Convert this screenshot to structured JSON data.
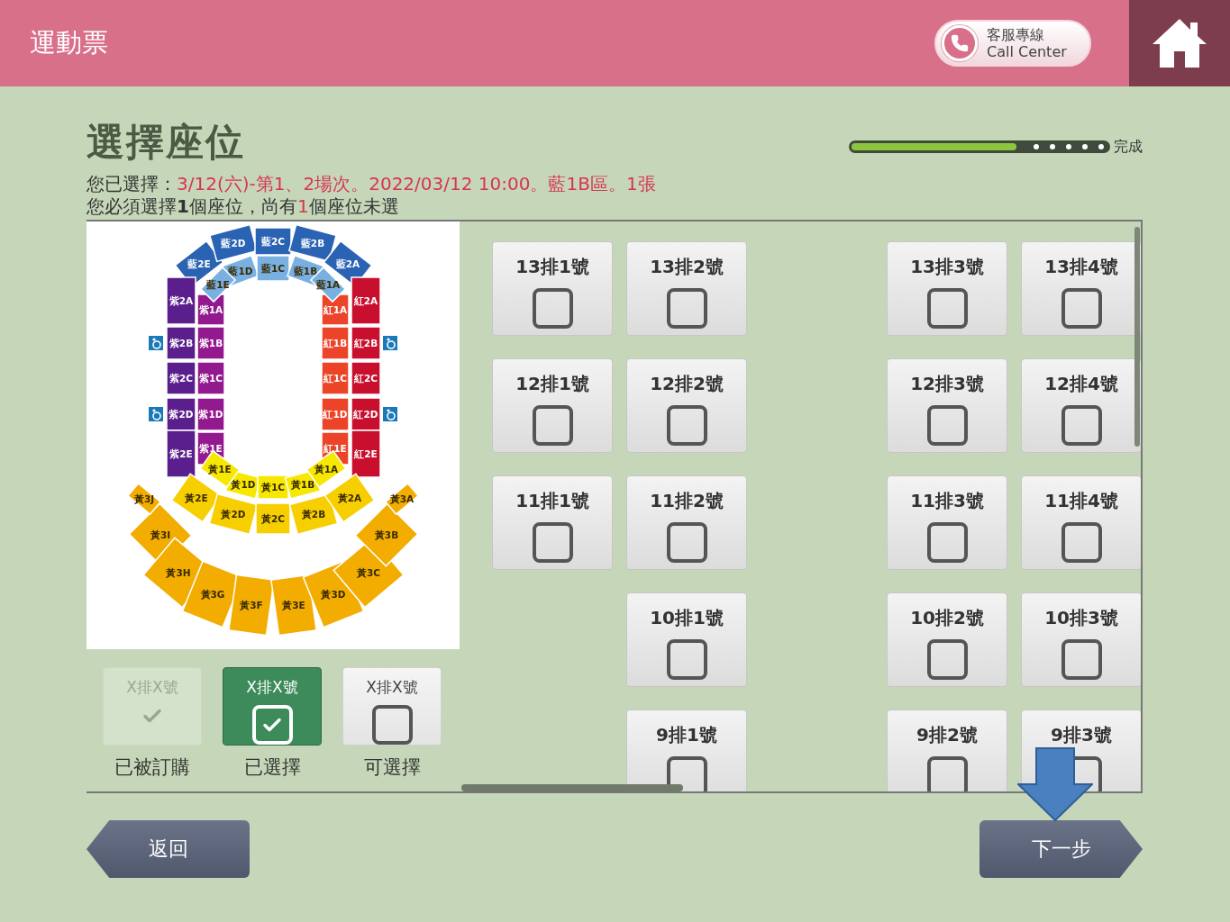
{
  "header": {
    "title": "運動票",
    "call_center": {
      "line_1": "客服專線",
      "line_2": "Call Center"
    }
  },
  "page_title": "選擇座位",
  "progress": {
    "level": 0.65,
    "label": "完成"
  },
  "summary_lines": [
    {
      "segments": [
        {
          "text": "您已選擇：",
          "kind": "plain"
        },
        {
          "text": "3/12(六)-第1、2場次。2022/03/12 10:00。藍1B區。1張",
          "kind": "selection"
        }
      ]
    },
    {
      "segments": [
        {
          "text": "您必須選擇",
          "kind": "plain"
        },
        {
          "text": "1",
          "kind": "required"
        },
        {
          "text": "個座位，尚有",
          "kind": "plain"
        },
        {
          "text": "1",
          "kind": "remaining"
        },
        {
          "text": "個座位未選",
          "kind": "plain"
        }
      ]
    }
  ],
  "seat_map": {
    "rings": [
      {
        "sections": [
          {
            "label": "藍2E",
            "color": "#2a63b3"
          },
          {
            "label": "藍2D",
            "color": "#2a63b3"
          },
          {
            "label": "藍2C",
            "color": "#2a63b3"
          },
          {
            "label": "藍2B",
            "color": "#2a63b3"
          },
          {
            "label": "藍2A",
            "color": "#2a63b3"
          }
        ]
      },
      {
        "sections": [
          {
            "label": "藍1E",
            "color": "#79b0e2"
          },
          {
            "label": "藍1D",
            "color": "#79b0e2"
          },
          {
            "label": "藍1C",
            "color": "#79b0e2"
          },
          {
            "label": "藍1B",
            "color": "#79b0e2"
          },
          {
            "label": "藍1A",
            "color": "#79b0e2"
          }
        ]
      },
      {
        "sections": [
          {
            "label": "紫2A",
            "color": "#5a1f8c"
          },
          {
            "label": "紫2B",
            "color": "#5a1f8c"
          },
          {
            "label": "紫2C",
            "color": "#5a1f8c"
          },
          {
            "label": "紫2D",
            "color": "#5a1f8c"
          },
          {
            "label": "紫2E",
            "color": "#5a1f8c"
          }
        ]
      },
      {
        "sections": [
          {
            "label": "紫1A",
            "color": "#93198f"
          },
          {
            "label": "紫1B",
            "color": "#93198f"
          },
          {
            "label": "紫1C",
            "color": "#93198f"
          },
          {
            "label": "紫1D",
            "color": "#93198f"
          },
          {
            "label": "紫1E",
            "color": "#93198f"
          }
        ]
      },
      {
        "sections": [
          {
            "label": "紅1A",
            "color": "#ec4428"
          },
          {
            "label": "紅1B",
            "color": "#ec4428"
          },
          {
            "label": "紅1C",
            "color": "#ec4428"
          },
          {
            "label": "紅1D",
            "color": "#ec4428"
          },
          {
            "label": "紅1E",
            "color": "#ec4428"
          }
        ]
      },
      {
        "sections": [
          {
            "label": "紅2A",
            "color": "#c8102e"
          },
          {
            "label": "紅2B",
            "color": "#c8102e"
          },
          {
            "label": "紅2C",
            "color": "#c8102e"
          },
          {
            "label": "紅2D",
            "color": "#c8102e"
          },
          {
            "label": "紅2E",
            "color": "#c8102e"
          }
        ]
      },
      {
        "sections": [
          {
            "label": "黃1E",
            "color": "#f6e800"
          },
          {
            "label": "黃1D",
            "color": "#f6e800"
          },
          {
            "label": "黃1C",
            "color": "#f6e800"
          },
          {
            "label": "黃1B",
            "color": "#f6e800"
          },
          {
            "label": "黃1A",
            "color": "#f6e800"
          }
        ]
      },
      {
        "sections": [
          {
            "label": "黃2E",
            "color": "#f7cf00"
          },
          {
            "label": "黃2D",
            "color": "#f7cf00"
          },
          {
            "label": "黃2C",
            "color": "#f7cf00"
          },
          {
            "label": "黃2B",
            "color": "#f7cf00"
          },
          {
            "label": "黃2A",
            "color": "#f7cf00"
          }
        ]
      },
      {
        "sections": [
          {
            "label": "黃3J",
            "color": "#f2ad00"
          },
          {
            "label": "黃3I",
            "color": "#f2ad00"
          },
          {
            "label": "黃3H",
            "color": "#f2ad00"
          },
          {
            "label": "黃3G",
            "color": "#f2ad00"
          },
          {
            "label": "黃3F",
            "color": "#f2ad00"
          },
          {
            "label": "黃3E",
            "color": "#f2ad00"
          },
          {
            "label": "黃3D",
            "color": "#f2ad00"
          },
          {
            "label": "黃3C",
            "color": "#f2ad00"
          },
          {
            "label": "黃3B",
            "color": "#f2ad00"
          },
          {
            "label": "黃3A",
            "color": "#f2ad00"
          }
        ]
      }
    ]
  },
  "legend": [
    {
      "kind": "sold",
      "label": "X排X號",
      "caption": "已被訂購",
      "checked": true
    },
    {
      "kind": "selected",
      "label": "X排X號",
      "caption": "已選擇",
      "checked": true
    },
    {
      "kind": "available",
      "label": "X排X號",
      "caption": "可選擇",
      "checked": false
    }
  ],
  "seat_rows": [
    {
      "seats": [
        {
          "label": "13排1號",
          "checked": false
        },
        {
          "label": "13排2號",
          "checked": false
        },
        {
          "label": "13排3號",
          "checked": false
        },
        {
          "label": "13排4號",
          "checked": false
        }
      ]
    },
    {
      "seats": [
        {
          "label": "12排1號",
          "checked": false
        },
        {
          "label": "12排2號",
          "checked": false
        },
        {
          "label": "12排3號",
          "checked": false
        },
        {
          "label": "12排4號",
          "checked": false
        }
      ]
    },
    {
      "seats": [
        {
          "label": "11排1號",
          "checked": false
        },
        {
          "label": "11排2號",
          "checked": false
        },
        {
          "label": "11排3號",
          "checked": false
        },
        {
          "label": "11排4號",
          "checked": false
        }
      ]
    },
    {
      "seats": [
        {
          "label": "10排1號",
          "checked": false
        },
        {
          "label": "10排2號",
          "checked": false
        },
        {
          "label": "10排3號",
          "checked": false
        }
      ]
    },
    {
      "seats": [
        {
          "label": "9排1號",
          "checked": false
        },
        {
          "label": "9排2號",
          "checked": false
        },
        {
          "label": "9排3號",
          "checked": false
        }
      ]
    }
  ],
  "buttons": {
    "back": "返回",
    "next": "下一步"
  }
}
